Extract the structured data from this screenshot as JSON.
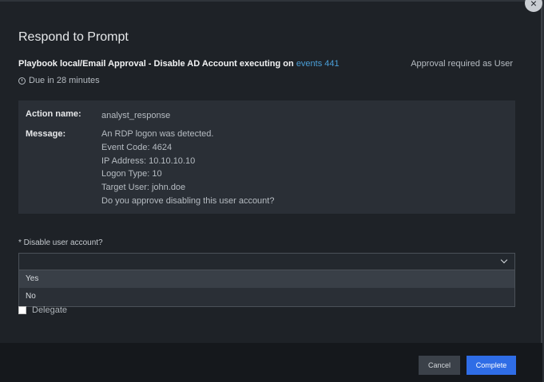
{
  "dialog": {
    "title": "Respond to Prompt",
    "close_label": "×",
    "playbook_text": "Playbook local/Email Approval - Disable AD Account executing on",
    "event_link": "events 441",
    "approval_text": "Approval required as User",
    "due_text": "Due in 28 minutes"
  },
  "info": {
    "action_label": "Action name:",
    "action_value": "analyst_response",
    "message_label": "Message:",
    "message_lines": [
      "An RDP logon was detected.",
      "Event Code: 4624",
      "IP Address: 10.10.10.10",
      "Logon Type: 10",
      "Target User: john.doe",
      "Do you approve disabling this user account?"
    ]
  },
  "question": {
    "label": "* Disable user account?",
    "selected_value": "",
    "options": [
      "Yes",
      "No"
    ]
  },
  "delegate": {
    "label": "Delegate",
    "checked": false
  },
  "footer": {
    "cancel_label": "Cancel",
    "complete_label": "Complete"
  },
  "colors": {
    "link": "#4a9fd8",
    "primary_button": "#2f6de6",
    "background": "#1e2227"
  },
  "icons": {
    "close": "close-icon",
    "clock": "clock-icon",
    "chevron": "chevron-down-icon"
  }
}
